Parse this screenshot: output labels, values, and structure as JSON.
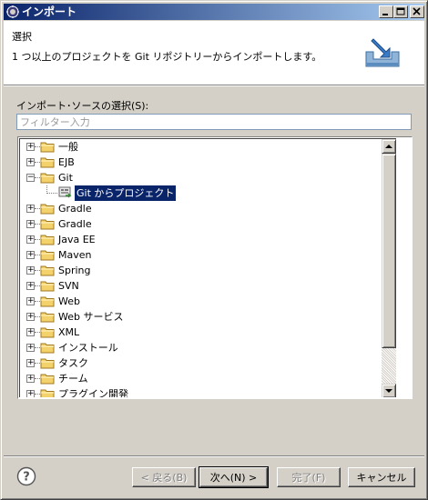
{
  "window": {
    "title": "インポート",
    "controls": [
      "minimize-icon",
      "maximize-icon",
      "close-icon"
    ]
  },
  "header": {
    "title": "選択",
    "description": "1 つ以上のプロジェクトを Git リポジトリーからインポートします。",
    "icon": "import-wizard-icon"
  },
  "source": {
    "label": "インポート･ソースの選択(S):",
    "filter_placeholder": "フィルター入力",
    "filter_value": ""
  },
  "tree": {
    "items": [
      {
        "label": "一般",
        "state": "collapsed",
        "level": 0
      },
      {
        "label": "EJB",
        "state": "collapsed",
        "level": 0
      },
      {
        "label": "Git",
        "state": "expanded",
        "level": 0
      },
      {
        "label": "Git からプロジェクト",
        "state": "leaf",
        "level": 1,
        "selected": true
      },
      {
        "label": "Gradle",
        "state": "collapsed",
        "level": 0
      },
      {
        "label": "Gradle",
        "state": "collapsed",
        "level": 0
      },
      {
        "label": "Java EE",
        "state": "collapsed",
        "level": 0
      },
      {
        "label": "Maven",
        "state": "collapsed",
        "level": 0
      },
      {
        "label": "Spring",
        "state": "collapsed",
        "level": 0
      },
      {
        "label": "SVN",
        "state": "collapsed",
        "level": 0
      },
      {
        "label": "Web",
        "state": "collapsed",
        "level": 0
      },
      {
        "label": "Web サービス",
        "state": "collapsed",
        "level": 0
      },
      {
        "label": "XML",
        "state": "collapsed",
        "level": 0
      },
      {
        "label": "インストール",
        "state": "collapsed",
        "level": 0
      },
      {
        "label": "タスク",
        "state": "collapsed",
        "level": 0
      },
      {
        "label": "チーム",
        "state": "collapsed",
        "level": 0
      },
      {
        "label": "プラグイン開発",
        "state": "collapsed",
        "level": 0
      }
    ]
  },
  "buttons": {
    "back": "< 戻る(B)",
    "next": "次へ(N) >",
    "finish": "完了(F)",
    "cancel": "キャンセル"
  },
  "colors": {
    "titlebar_start": "#0a246a",
    "titlebar_end": "#a6caf0",
    "selection": "#0a246a",
    "dialog_bg": "#d4d0c8",
    "folder": "#f4d26b"
  }
}
